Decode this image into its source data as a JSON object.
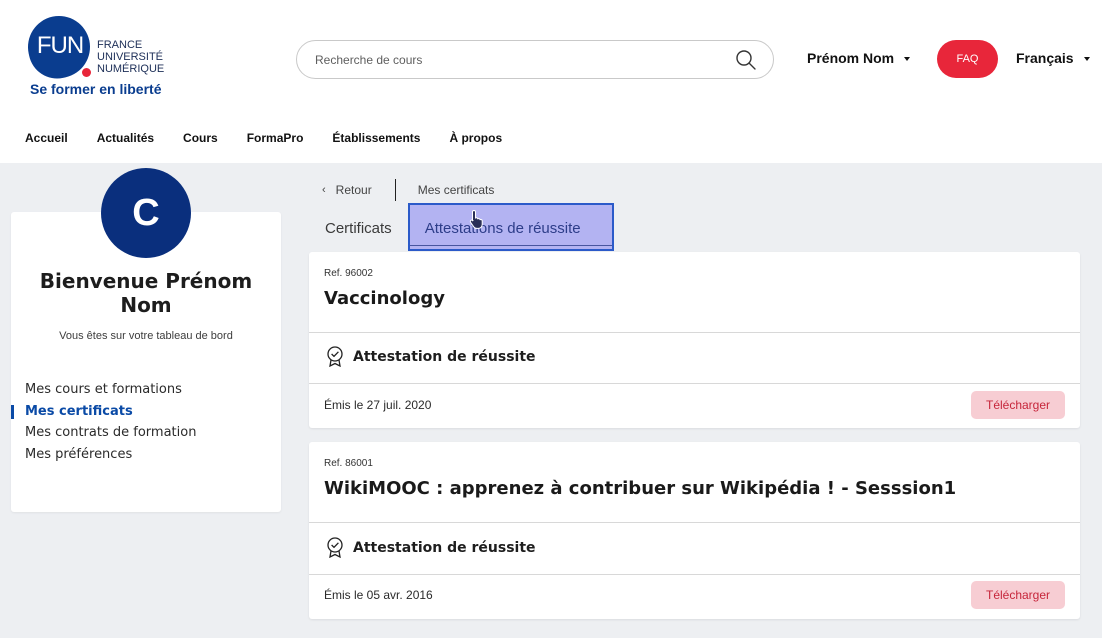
{
  "brand": {
    "logo_mark": "FUN",
    "logo_line1": "FRANCE",
    "logo_line2": "UNIVERSITÉ",
    "logo_line3": "NUMÉRIQUE",
    "tagline": "Se former en liberté",
    "primary_color": "#0a3d8f",
    "accent_color": "#e8263a"
  },
  "header": {
    "search_placeholder": "Recherche de cours",
    "search_icon": "search-icon",
    "user_name": "Prénom Nom",
    "faq_label": "FAQ",
    "language": "Français"
  },
  "nav": {
    "items": [
      "Accueil",
      "Actualités",
      "Cours",
      "FormaPro",
      "Établissements",
      "À propos"
    ]
  },
  "profile": {
    "avatar_letter": "C",
    "welcome": "Bienvenue Prénom Nom",
    "subtitle": "Vous êtes sur votre tableau de bord",
    "menu": [
      "Mes cours et formations",
      "Mes certificats",
      "Mes contrats de formation",
      "Mes préférences"
    ],
    "active_item": "Mes certificats"
  },
  "breadcrumb": {
    "back_label": "Retour",
    "current": "Mes certificats"
  },
  "tabs": {
    "items": [
      "Certificats",
      "Attestations de réussite"
    ],
    "active": "Attestations de réussite"
  },
  "certificates": [
    {
      "ref": "Ref. 96002",
      "title": "Vaccinology",
      "type": "Attestation de réussite",
      "date": "Émis le 27 juil. 2020",
      "download_label": "Télécharger"
    },
    {
      "ref": "Ref. 86001",
      "title": "WikiMOOC : apprenez à contribuer sur Wikipédia ! - Sesssion1",
      "type": "Attestation de réussite",
      "date": "Émis le 05 avr. 2016",
      "download_label": "Télécharger"
    }
  ]
}
